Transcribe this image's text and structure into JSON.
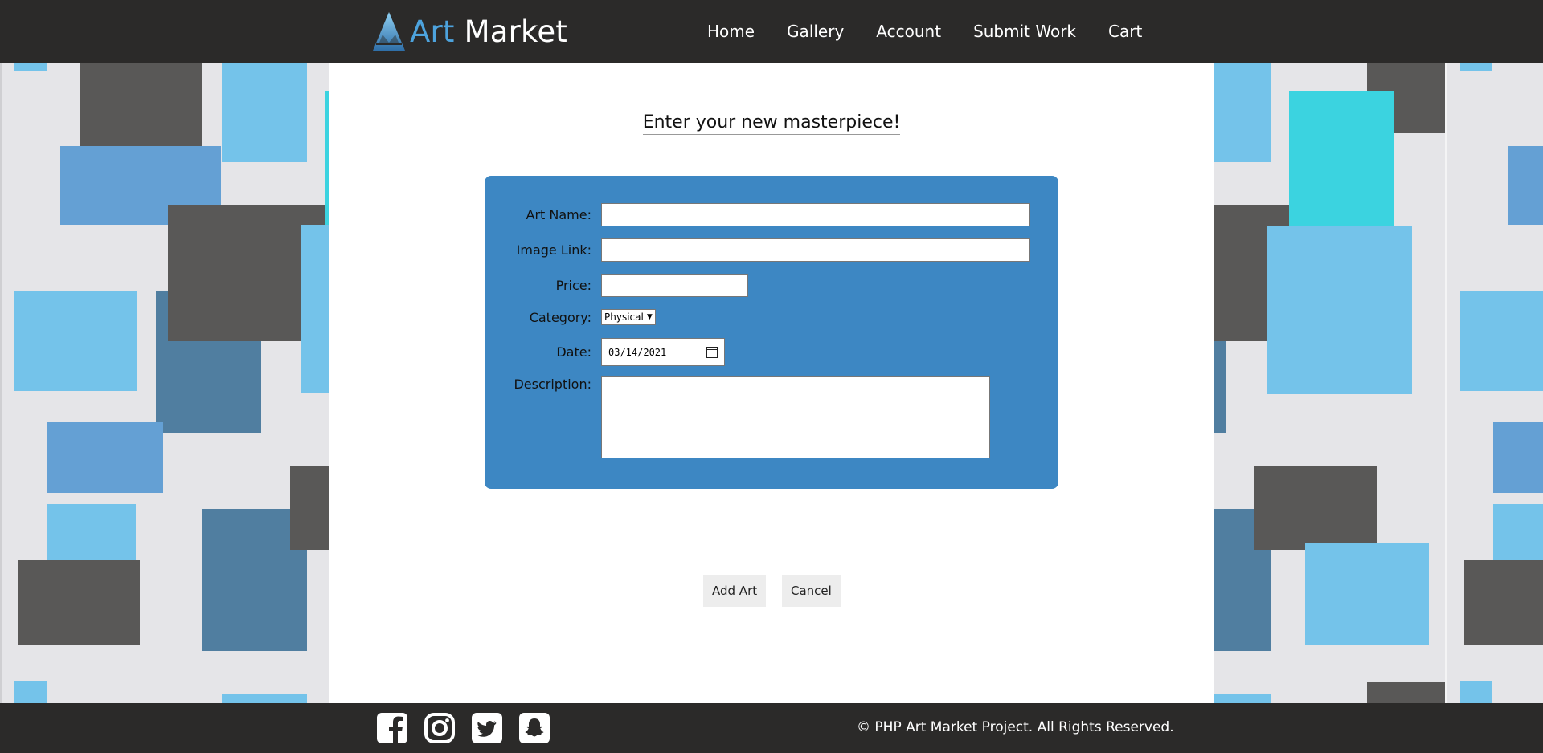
{
  "brand": {
    "name_part1": "Art",
    "name_part2": "Market"
  },
  "nav": {
    "items": [
      "Home",
      "Gallery",
      "Account",
      "Submit Work",
      "Cart"
    ]
  },
  "page": {
    "title": "Enter your new masterpiece!"
  },
  "form": {
    "art_name_label": "Art Name:",
    "art_name_value": "",
    "image_link_label": "Image Link:",
    "image_link_value": "",
    "price_label": "Price:",
    "price_value": "",
    "category_label": "Category:",
    "category_selected": "Physical",
    "date_label": "Date:",
    "date_value": "03/14/2021",
    "description_label": "Description:",
    "description_value": ""
  },
  "buttons": {
    "add_art": "Add Art",
    "cancel": "Cancel"
  },
  "footer": {
    "social_icons": [
      "facebook-icon",
      "instagram-icon",
      "twitter-icon",
      "snapchat-icon"
    ],
    "copyright": "© PHP Art Market Project. All Rights Reserved."
  },
  "colors": {
    "header_bg": "#2b2a29",
    "form_bg": "#3d87c3",
    "accent_blue": "#4da3dd",
    "tile_dark": "#595857",
    "tile_light_blue": "#74c3ea",
    "tile_mid_blue": "#64a0d4",
    "tile_steel": "#507ea0",
    "tile_cyan": "#3bd3e0"
  }
}
